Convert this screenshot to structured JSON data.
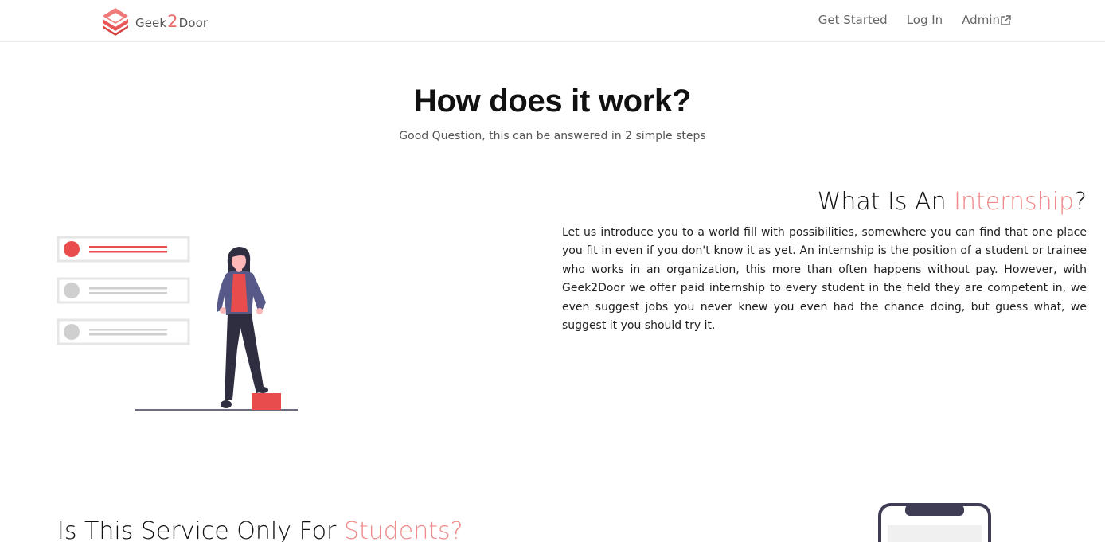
{
  "navbar": {
    "brand": {
      "part1": "Geek",
      "part2": "2",
      "part3": "Door"
    },
    "links": [
      {
        "label": "Get Started"
      },
      {
        "label": "Log In"
      },
      {
        "label": "Admin",
        "icon": "external-link-icon"
      }
    ]
  },
  "hero": {
    "title": "How does it work?",
    "subtitle": "Good Question, this can be answered in 2 simple steps"
  },
  "internship_section": {
    "heading_prefix": "What Is An ",
    "heading_accent": "Internship",
    "heading_suffix": "?",
    "body": "Let us introduce you to a world fill with possibilities, somewhere you can find that one place you fit in even if you don't know it as yet. An internship is the position of a student or trainee who works in an organization, this more than often happens without pay. However, with Geek2Door we offer paid internship to every student in the field they are competent in, we even suggest jobs you never knew you even had the chance doing, but guess what, we suggest it you should try it.",
    "illustration": "woman-with-checklist-illustration"
  },
  "students_section": {
    "heading_prefix": "Is This Service Only For ",
    "heading_accent": "Students?",
    "illustration": "phone-illustration"
  },
  "colors": {
    "accent": "#ef8a8a",
    "brand_red": "#ea5a5a",
    "text_dark": "#111111",
    "text_muted": "#555555",
    "illustration_navy": "#3f3d56",
    "illustration_coat": "#575a89"
  }
}
